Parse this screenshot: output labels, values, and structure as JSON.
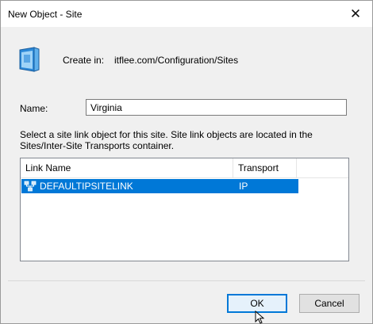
{
  "window": {
    "title": "New Object - Site",
    "close_glyph": "✕"
  },
  "create_in": {
    "label": "Create in:",
    "value": "itflee.com/Configuration/Sites"
  },
  "name_field": {
    "label": "Name:",
    "value": "Virginia"
  },
  "description": "Select a site link object for this site. Site link objects are located in the Sites/Inter-Site Transports container.",
  "link_table": {
    "columns": [
      "Link Name",
      "Transport"
    ],
    "rows": [
      {
        "name": "DEFAULTIPSITELINK",
        "transport": "IP",
        "selected": true
      }
    ]
  },
  "buttons": {
    "ok": "OK",
    "cancel": "Cancel"
  },
  "colors": {
    "selection": "#0078d7",
    "ok_border": "#0078d7"
  }
}
